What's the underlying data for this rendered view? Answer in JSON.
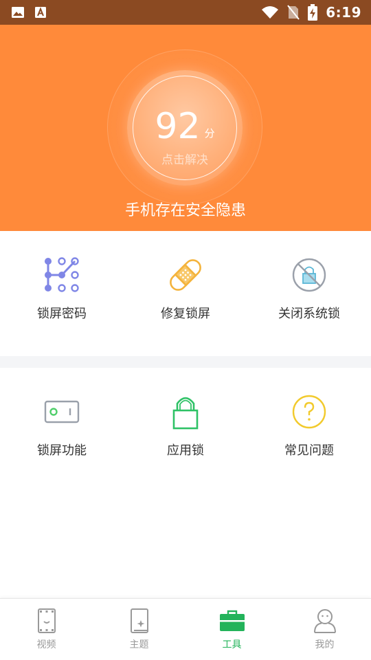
{
  "status_bar": {
    "time": "6:19",
    "icons": [
      "image-icon",
      "font-icon",
      "wifi-icon",
      "no-sim-icon",
      "battery-charging-icon"
    ]
  },
  "header": {
    "score": "92",
    "score_unit": "分",
    "action": "点击解决",
    "warning": "手机存在安全隐患",
    "bg_color": "#ff8a3a"
  },
  "tools_row1": [
    {
      "label": "锁屏密码",
      "icon": "pattern-lock-icon"
    },
    {
      "label": "修复锁屏",
      "icon": "bandage-icon"
    },
    {
      "label": "关闭系统锁",
      "icon": "disable-lock-icon"
    }
  ],
  "tools_row2": [
    {
      "label": "锁屏功能",
      "icon": "toggle-switch-icon"
    },
    {
      "label": "应用锁",
      "icon": "padlock-icon"
    },
    {
      "label": "常见问题",
      "icon": "question-icon"
    }
  ],
  "bottom_nav": [
    {
      "label": "视频",
      "icon": "video-icon",
      "active": false
    },
    {
      "label": "主题",
      "icon": "theme-icon",
      "active": false
    },
    {
      "label": "工具",
      "icon": "toolbox-icon",
      "active": true
    },
    {
      "label": "我的",
      "icon": "profile-icon",
      "active": false
    }
  ],
  "colors": {
    "accent": "#23b35a",
    "header": "#ff8a3a",
    "status_bar": "#8b4a22"
  }
}
